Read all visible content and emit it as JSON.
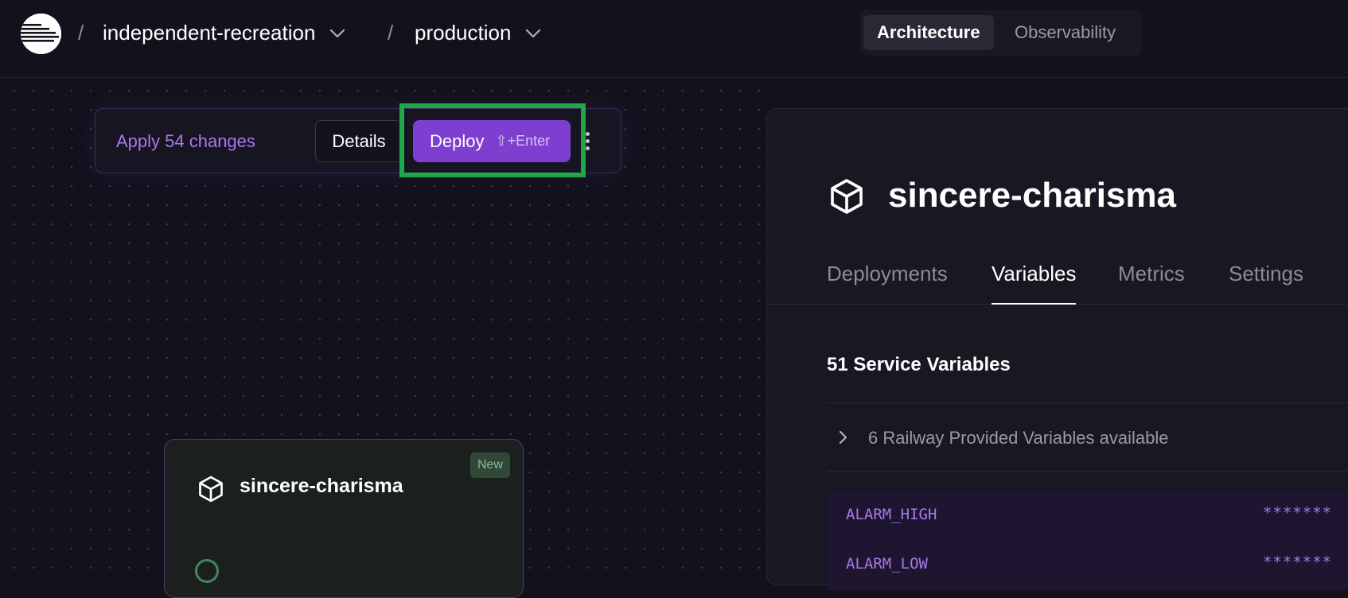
{
  "breadcrumb": {
    "project": "independent-recreation",
    "environment": "production",
    "separator": "/"
  },
  "view_toggle": {
    "options": [
      "Architecture",
      "Observability"
    ],
    "selected": "Architecture"
  },
  "changes_bar": {
    "apply_text": "Apply 54 changes",
    "details_label": "Details",
    "deploy_label": "Deploy",
    "deploy_shortcut": "⇧+Enter"
  },
  "service_card": {
    "badge": "New",
    "name": "sincere-charisma"
  },
  "panel": {
    "title": "sincere-charisma",
    "tabs": [
      "Deployments",
      "Variables",
      "Metrics",
      "Settings"
    ],
    "active_tab": "Variables",
    "variables_heading": "51 Service Variables",
    "provided_variables_text": "6 Railway Provided Variables available",
    "variables": [
      {
        "name": "ALARM_HIGH",
        "value": "*******"
      },
      {
        "name": "ALARM_LOW",
        "value": "*******"
      }
    ]
  },
  "colors": {
    "accent": "#7e3fd0",
    "accent_text": "#a57ae8",
    "highlight": "#1fa84a",
    "background": "#13111c"
  },
  "icons": [
    "railway-logo-icon",
    "chevron-down-icon",
    "cube-icon",
    "more-vertical-icon",
    "chevron-right-icon",
    "status-circle-icon"
  ]
}
